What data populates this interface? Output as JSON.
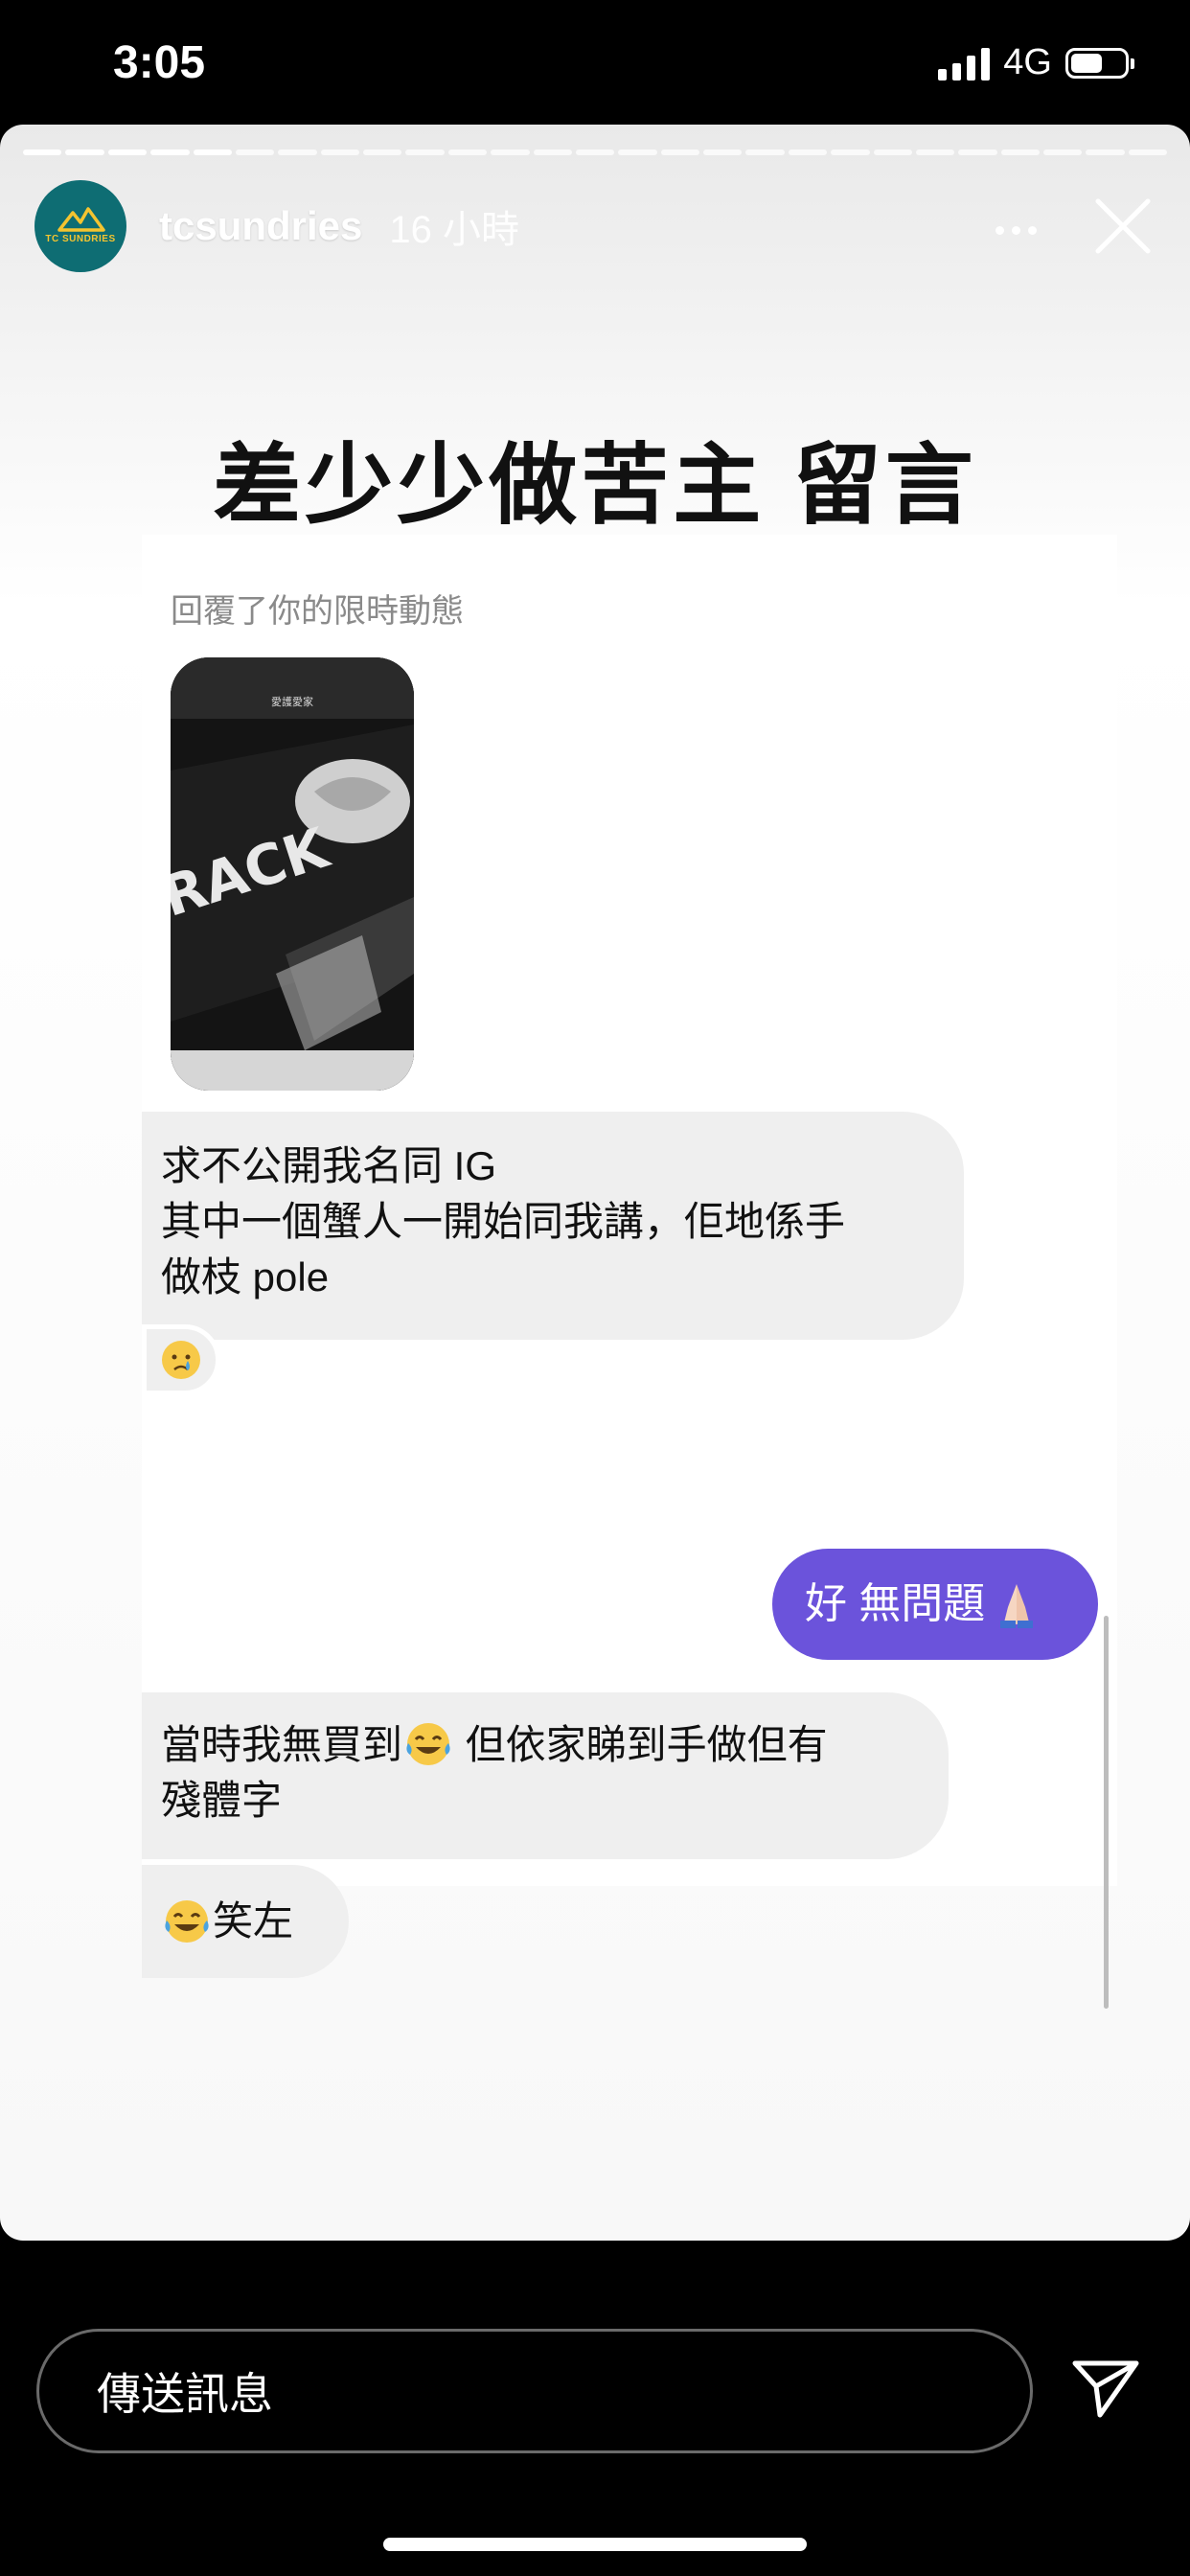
{
  "status_bar": {
    "time": "3:05",
    "network": "4G",
    "battery_percent": 60
  },
  "story": {
    "progress": {
      "total_segments": 27,
      "completed_segments": 5
    },
    "account": {
      "username": "tcsundries",
      "time_ago": "16 小時",
      "avatar_text": "TC SUNDRIES"
    },
    "title": "差少少做苦主 留言",
    "dm": {
      "reply_note": "回覆了你的限時動態",
      "reply_image_caption": "愛護愛家",
      "messages": [
        {
          "from": "other",
          "lines": [
            "求不公開我名同 IG",
            "其中一個蟹人一開始同我講，佢地係手",
            "做枝 pole"
          ],
          "reaction": "crying-face"
        },
        {
          "from": "me",
          "text": "好 無問題",
          "emoji": "folded-hands"
        },
        {
          "from": "other",
          "part1": "當時我無買到",
          "emoji": "tears-of-joy",
          "part2": " 但依家睇到手做但有",
          "line2": "殘體字"
        },
        {
          "from": "other",
          "emoji": "tears-of-joy",
          "text": "笑左"
        }
      ]
    }
  },
  "bottom_bar": {
    "message_placeholder": "傳送訊息"
  },
  "colors": {
    "my_bubble": "#6b53db",
    "their_bubble": "#efefef",
    "avatar_bg": "#0e6d73"
  }
}
